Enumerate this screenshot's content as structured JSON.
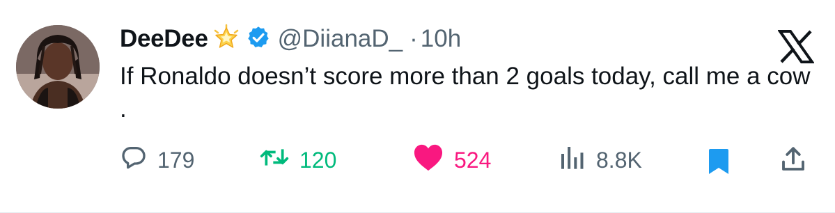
{
  "author": {
    "display_name": "DeeDee",
    "name_emoji": "glowing-star-emoji",
    "verified": true,
    "handle": "@DiianaD_",
    "separator": "·",
    "time": "10h"
  },
  "tweet": {
    "text": "If Ronaldo doesn’t score more than 2 goals today, call me a cow ."
  },
  "actions": {
    "replies": "179",
    "retweets": "120",
    "likes": "524",
    "views": "8.8K",
    "bookmarked": true,
    "liked": true,
    "retweeted": true
  },
  "icons": {
    "reply": "reply-bubble-icon",
    "retweet": "retweet-icon",
    "like": "heart-icon",
    "views": "views-bar-chart-icon",
    "bookmark": "bookmark-icon",
    "share": "share-icon",
    "platform": "x-logo-icon"
  },
  "colors": {
    "text_primary": "#0f1419",
    "text_secondary": "#536471",
    "verified": "#1d9bf0",
    "retweet": "#00ba7c",
    "like": "#f91880",
    "bookmark": "#1d9bf0"
  }
}
